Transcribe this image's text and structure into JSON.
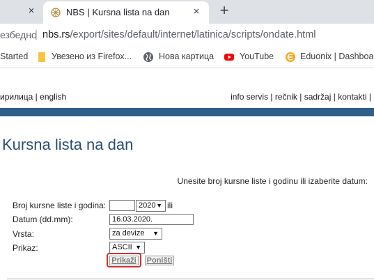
{
  "browser": {
    "prev_tab_close": "×",
    "active_tab": {
      "title": "NBS | Kursna lista na dan",
      "close": "×"
    },
    "new_tab": "+",
    "address": {
      "security_text": "езбедно",
      "separator": "|",
      "host": "nbs.rs",
      "path": "/export/sites/default/internet/latinica/scripts/ondate.html"
    },
    "bookmarks": [
      {
        "label": "Started"
      },
      {
        "label": "Увезено из Firefox..."
      },
      {
        "label": "Нова картица"
      },
      {
        "label": "YouTube"
      },
      {
        "label": "Eduonix | Dashboar..."
      }
    ]
  },
  "page": {
    "lang": {
      "cyrillic": "ирилица",
      "sep": " | ",
      "english": "english"
    },
    "topnav": [
      {
        "label": "info servis"
      },
      {
        "label": "rečnik"
      },
      {
        "label": "sadržaj"
      },
      {
        "label": "kontakti"
      }
    ],
    "topnav_sep": " | ",
    "title": "Kursna lista na dan",
    "instruction": "Unesite broj kursne liste i godinu ili izaberite datum:",
    "form": {
      "broj_label": "Broj kursne liste i godina:",
      "broj_value": "",
      "year_value": "2020",
      "ili": "ili",
      "datum_label": "Datum (dd.mm):",
      "datum_value": "16.03.2020.",
      "vrsta_label": "Vrsta:",
      "vrsta_value": "za devize",
      "prikaz_label": "Prikaz:",
      "prikaz_value": "ASCII",
      "submit_label": "Prikaži",
      "reset_label": "Poništi"
    }
  },
  "colors": {
    "blue_bar": "#2d5f8b",
    "title": "#2b4e74",
    "highlight": "#d32f2f"
  }
}
